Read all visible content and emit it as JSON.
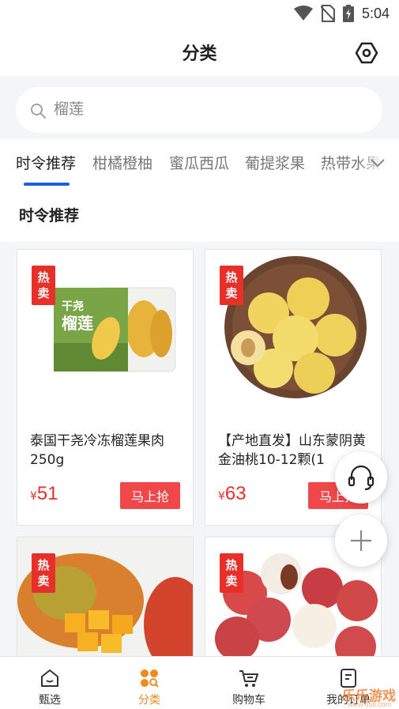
{
  "status_bar": {
    "time": "5:04",
    "icons": [
      "wifi-icon",
      "no-sim-icon",
      "battery-charging-icon"
    ]
  },
  "header": {
    "title": "分类",
    "action_icon": "settings-hexagon-icon"
  },
  "search": {
    "placeholder": "榴莲",
    "icon": "search-icon"
  },
  "tabs": [
    {
      "label": "时令推荐",
      "active": true
    },
    {
      "label": "柑橘橙柚",
      "active": false
    },
    {
      "label": "蜜瓜西瓜",
      "active": false
    },
    {
      "label": "葡提浆果",
      "active": false
    },
    {
      "label": "热带水果",
      "active": false
    }
  ],
  "section": {
    "title": "时令推荐"
  },
  "products": [
    {
      "badge_top": "热",
      "badge_bottom": "卖",
      "name": "泰国干尧冷冻榴莲果肉250g",
      "price_symbol": "¥",
      "price": "51",
      "button": "马上抢",
      "image": "durian-package-image",
      "package_label_1": "干尧",
      "package_label_2": "榴莲"
    },
    {
      "badge_top": "热",
      "badge_bottom": "卖",
      "name": "【产地直发】山东蒙阴黄金油桃10-12颗(1",
      "price_symbol": "¥",
      "price": "63",
      "button": "马上抢",
      "image": "yellow-peaches-image"
    },
    {
      "badge_top": "热",
      "badge_bottom": "卖",
      "image": "mango-image"
    },
    {
      "badge_top": "热",
      "badge_bottom": "卖",
      "image": "lychee-image"
    }
  ],
  "floating": {
    "support_icon": "headset-icon",
    "add_icon": "plus-icon"
  },
  "bottom_nav": [
    {
      "label": "甄选",
      "icon": "home-icon",
      "active": false
    },
    {
      "label": "分类",
      "icon": "category-grid-icon",
      "active": true
    },
    {
      "label": "购物车",
      "icon": "cart-icon",
      "active": false
    },
    {
      "label": "我的订单",
      "icon": "order-document-icon",
      "active": false
    }
  ],
  "watermark": {
    "text": "乐乐游戏",
    "sub": "www.55ll.com"
  },
  "colors": {
    "accent_blue": "#1f5fe0",
    "badge_red": "#e8302a",
    "price_red": "#e8302a",
    "nav_active": "#f08a1c"
  }
}
